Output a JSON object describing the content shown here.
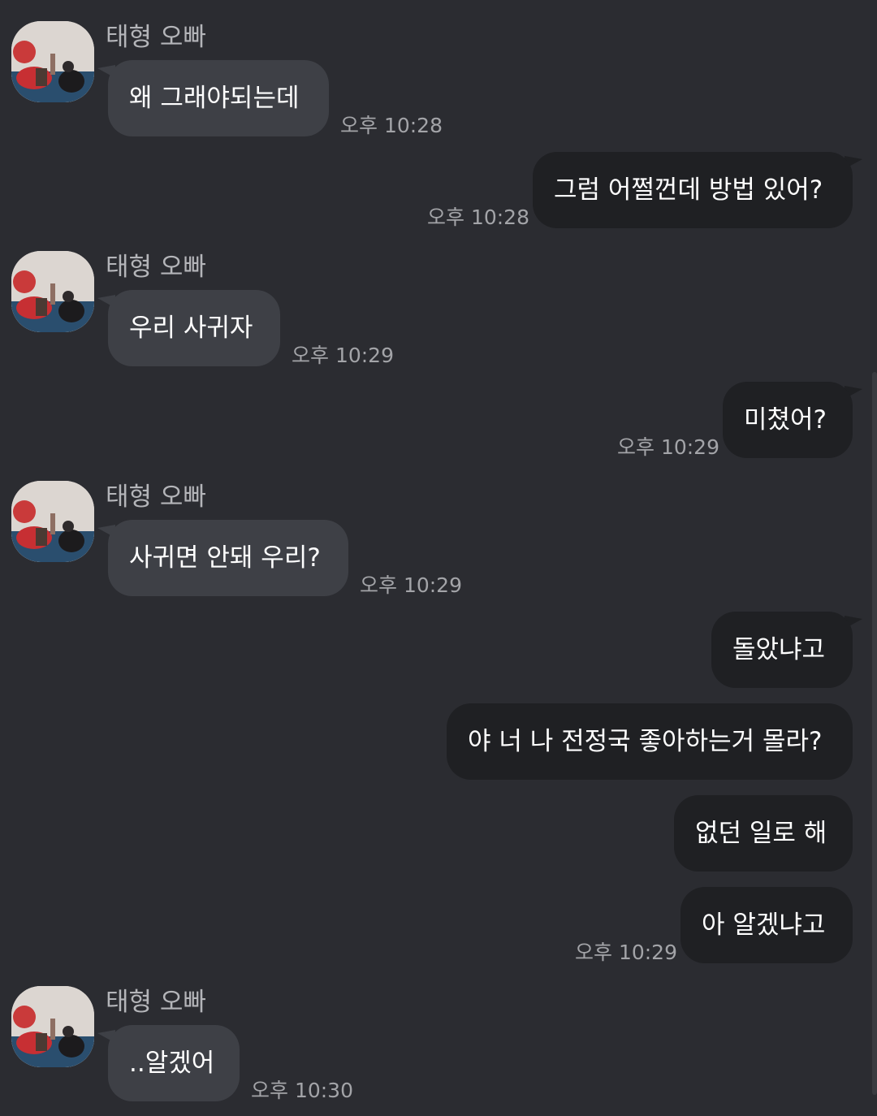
{
  "contact": {
    "name": "태형 오빠"
  },
  "messages": [
    {
      "side": "in",
      "text": "왜 그래야되는데",
      "time": "오후 10:28",
      "show_name": true
    },
    {
      "side": "out",
      "text": "그럼 어쩔껀데 방법 있어?",
      "time": "오후 10:28"
    },
    {
      "side": "in",
      "text": "우리 사귀자",
      "time": "오후 10:29",
      "show_name": true
    },
    {
      "side": "out",
      "text": "미쳤어?",
      "time": "오후 10:29"
    },
    {
      "side": "in",
      "text": "사귀면 안돼 우리?",
      "time": "오후 10:29",
      "show_name": true
    },
    {
      "side": "out",
      "text": "돌았냐고",
      "time": ""
    },
    {
      "side": "out",
      "text": "야 너 나 전정국 좋아하는거 몰라?",
      "time": ""
    },
    {
      "side": "out",
      "text": "없던 일로 해",
      "time": ""
    },
    {
      "side": "out",
      "text": "아 알겠냐고",
      "time": "오후 10:29"
    },
    {
      "side": "in",
      "text": "..알겠어",
      "time": "오후 10:30",
      "show_name": true
    }
  ],
  "colors": {
    "background": "#2b2c31",
    "incoming_bubble": "#3e4046",
    "outgoing_bubble": "#1f2023",
    "text": "#ffffff",
    "meta_text": "#a3a4a8"
  }
}
